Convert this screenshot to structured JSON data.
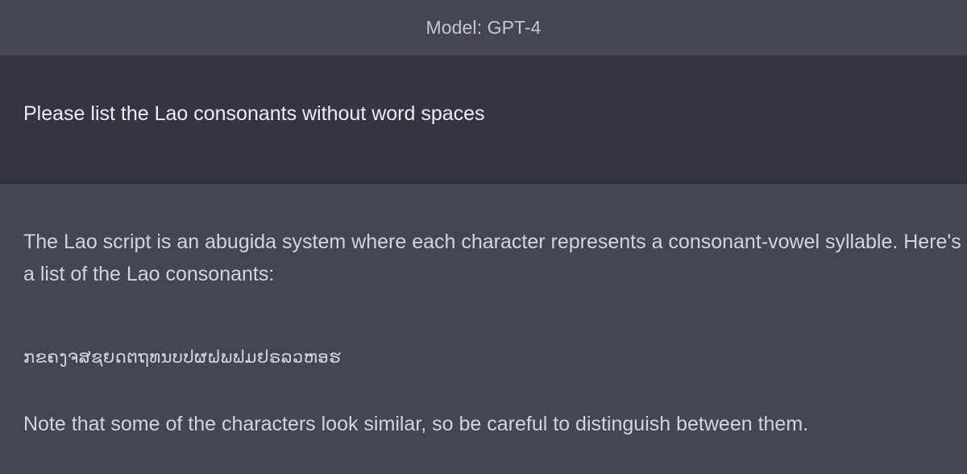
{
  "header": {
    "model_label": "Model: GPT-4"
  },
  "user_message": {
    "text": "Please list the Lao consonants without word spaces"
  },
  "assistant_message": {
    "paragraph_1": "The Lao script is an abugida system where each character represents a consonant-vowel syllable. Here's a list of the Lao consonants:",
    "consonants": "ກຂຄງຈສຊຍດຕຖທນບປຜຝພຟມຢຣລວຫອຮ",
    "paragraph_3": "Note that some of the characters look similar, so be careful to distinguish between them."
  }
}
